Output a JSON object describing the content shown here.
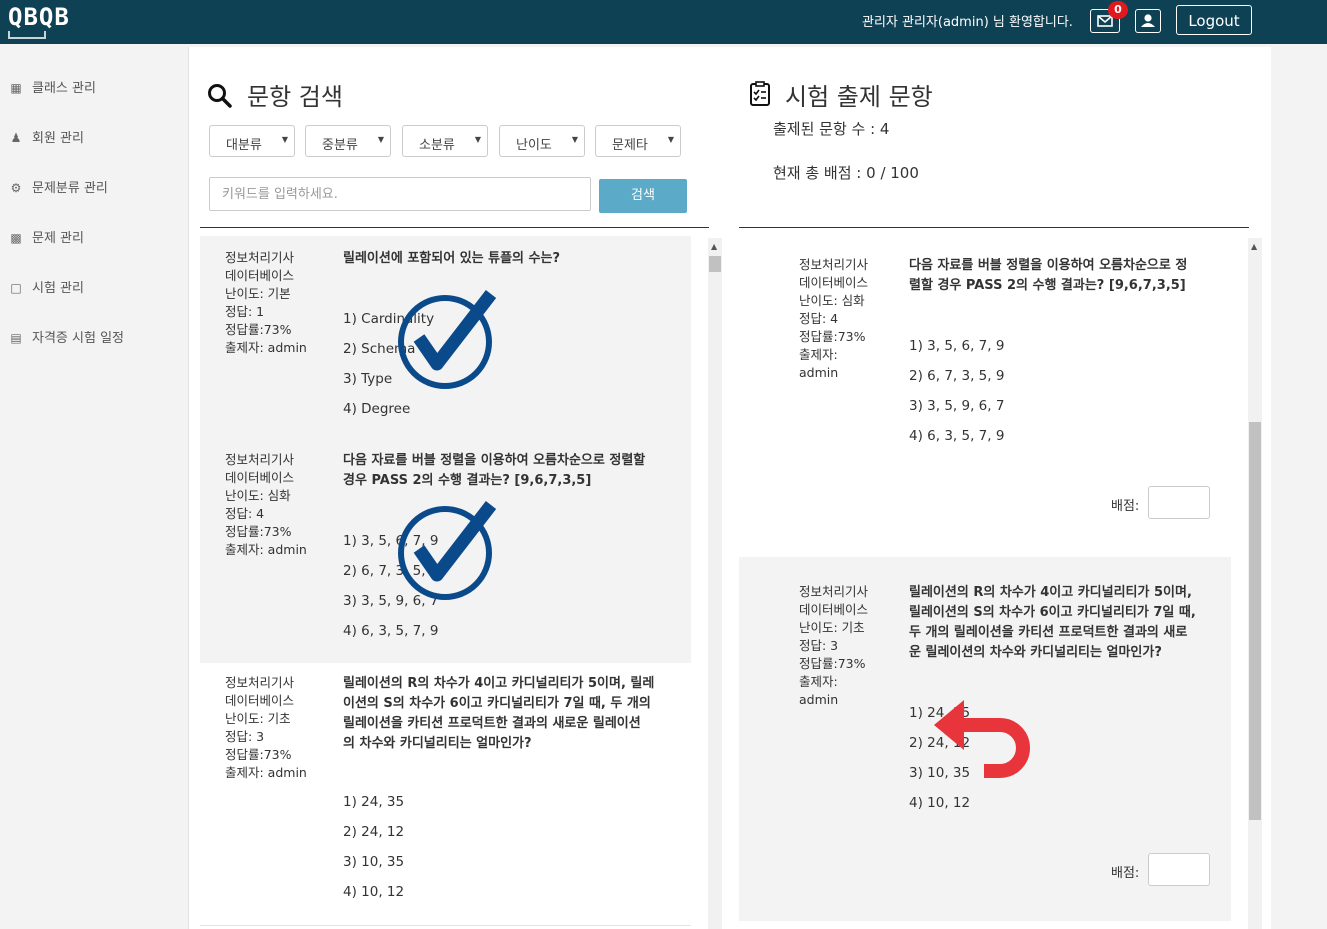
{
  "header": {
    "logo": "QBQB",
    "welcome": "관리자 관리자(admin) 님 환영합니다.",
    "mail_count": "0",
    "logout_label": "Logout"
  },
  "sidebar": {
    "items": [
      {
        "label": "클래스 관리",
        "icon": "grid-icon"
      },
      {
        "label": "회원 관리",
        "icon": "users-icon"
      },
      {
        "label": "문제분류 관리",
        "icon": "gears-icon"
      },
      {
        "label": "문제 관리",
        "icon": "puzzle-icon"
      },
      {
        "label": "시험 관리",
        "icon": "file-icon"
      },
      {
        "label": "자격증 시험 일정",
        "icon": "calendar-icon"
      }
    ]
  },
  "search": {
    "title": "문항 검색",
    "filters": [
      "대분류",
      "중분류",
      "소분류",
      "난이도",
      "문제타"
    ],
    "keyword_placeholder": "키워드를 입력하세요.",
    "button_label": "검색"
  },
  "exam": {
    "title": "시험 출제 문항",
    "count_text": "출제된 문항 수 : 4",
    "total_text": "현재 총 배점 : 0 / 100",
    "score_label": "배점:"
  },
  "search_results": [
    {
      "meta": [
        "정보처리기사",
        "데이터베이스",
        "난이도: 기본",
        "정답: 1",
        "정답률:73%",
        "출제자: admin"
      ],
      "question": [
        "릴레이션에 포함되어 있는 튜플의 수는?"
      ],
      "options": [
        "1)  Cardinality",
        "2)  Schema",
        "3)  Type",
        "4)  Degree"
      ],
      "selected": true
    },
    {
      "meta": [
        "정보처리기사",
        "데이터베이스",
        "난이도: 심화",
        "정답: 4",
        "정답률:73%",
        "출제자: admin"
      ],
      "question": [
        "다음 자료를 버블 정렬을 이용하여 오름차순으로 정렬할",
        "경우 PASS 2의 수행 결과는? [9,6,7,3,5]"
      ],
      "options": [
        "1)  3, 5, 6, 7, 9",
        "2)  6, 7, 3, 5, 9",
        "3)  3, 5, 9, 6, 7",
        "4)  6, 3, 5, 7, 9"
      ],
      "selected": true
    },
    {
      "meta": [
        "정보처리기사",
        "데이터베이스",
        "난이도: 기초",
        "정답: 3",
        "정답률:73%",
        "출제자: admin"
      ],
      "question": [
        "릴레이션의 R의 차수가 4이고 카디널리티가 5이며, 릴레",
        "이션의 S의 차수가 6이고 카디널리티가 7일 때, 두 개의",
        "릴레이션을 카티션 프로덕트한 결과의 새로운 릴레이션",
        "의 차수와 카디널리티는 얼마인가?"
      ],
      "options": [
        "1)  24, 35",
        "2)  24, 12",
        "3)  10, 35",
        "4)  10, 12"
      ],
      "selected": false
    }
  ],
  "exam_items": [
    {
      "meta": [
        "정보처리기사",
        "데이터베이스",
        "난이도: 심화",
        "정답: 4",
        "정답률:73%",
        "출제자:",
        "admin"
      ],
      "question": [
        "다음 자료를 버블 정렬을 이용하여 오름차순으로 정",
        "렬할 경우 PASS 2의 수행 결과는? [9,6,7,3,5]"
      ],
      "options": [
        "1)  3, 5, 6, 7, 9",
        "2)  6, 7, 3, 5, 9",
        "3)  3, 5, 9, 6, 7",
        "4)  6, 3, 5, 7, 9"
      ]
    },
    {
      "meta": [
        "정보처리기사",
        "데이터베이스",
        "난이도: 기초",
        "정답: 3",
        "정답률:73%",
        "출제자:",
        "admin"
      ],
      "question": [
        "릴레이션의 R의 차수가 4이고 카디널리티가 5이며,",
        "릴레이션의 S의 차수가 6이고 카디널리티가 7일 때,",
        "두 개의 릴레이션을 카티션 프로덕트한 결과의 새로",
        "운 릴레이션의 차수와 카디널리티는 얼마인가?"
      ],
      "options": [
        "1)  24, 35",
        "2)  24, 12",
        "3)  10, 35",
        "4)  10, 12"
      ]
    }
  ],
  "colors": {
    "header_bg": "#0f4154",
    "search_button": "#5aaac8",
    "check_mark": "#0b4a8a",
    "undo_arrow": "#e8353c",
    "badge": "#e0191f"
  }
}
